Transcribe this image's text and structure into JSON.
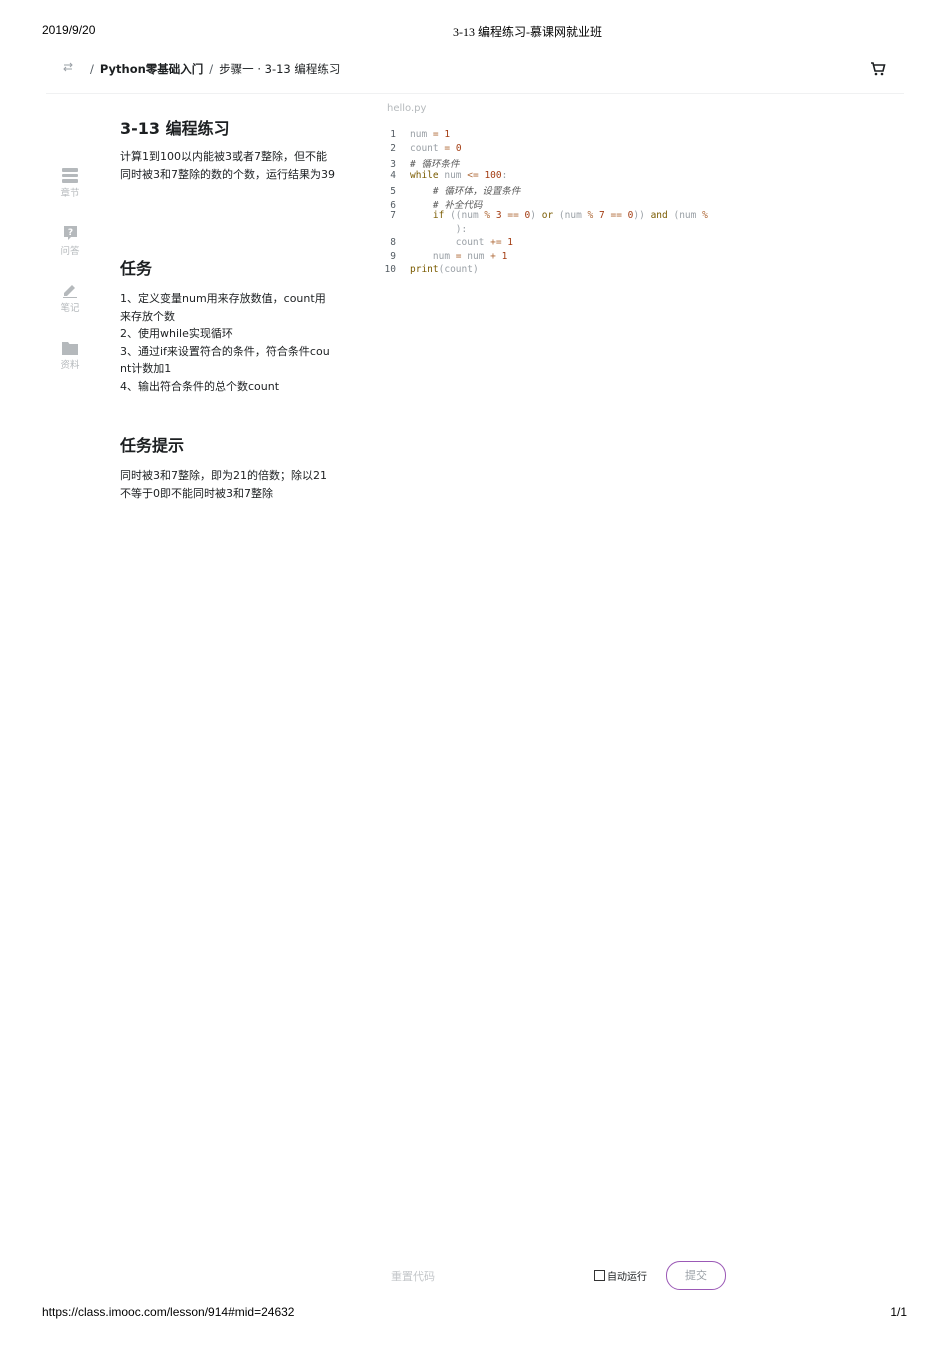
{
  "print_header": {
    "date": "2019/9/20",
    "title": "3-13 编程练习-慕课网就业班"
  },
  "print_footer": {
    "url": "https://class.imooc.com/lesson/914#mid=24632",
    "page": "1/1"
  },
  "topbar": {
    "separator": "/",
    "course": "Python零基础入门",
    "step": "步骤一 · 3-13 编程练习",
    "icons": {
      "swap": "swap-arrows-icon",
      "cart": "cart-icon"
    }
  },
  "sidenav": [
    {
      "label": "章节",
      "icon": "chapter-list-icon"
    },
    {
      "label": "问答",
      "icon": "question-icon"
    },
    {
      "label": "笔记",
      "icon": "pencil-icon"
    },
    {
      "label": "资料",
      "icon": "folder-icon"
    }
  ],
  "exercise": {
    "title": "3-13 编程练习",
    "description": "计算1到100以内能被3或者7整除，但不能同时被3和7整除的数的个数，运行结果为39",
    "task_heading": "任务",
    "tasks": [
      "1、定义变量num用来存放数值，count用来存放个数",
      "2、使用while实现循环",
      "3、通过if来设置符合的条件，符合条件count计数加1",
      "4、输出符合条件的总个数count"
    ],
    "hint_heading": "任务提示",
    "hint": "同时被3和7整除，即为21的倍数；除以21不等于0即不能同时被3和7整除"
  },
  "editor": {
    "file_name": "hello.py",
    "line_numbers": [
      "1",
      "2",
      "3",
      "4",
      "5",
      "6",
      "7",
      "",
      "8",
      "9",
      "10"
    ],
    "code_lines": [
      "num = 1",
      "count = 0",
      "# 循环条件",
      "while num <= 100:",
      "    # 循环体，设置条件",
      "    # 补全代码",
      "    if ((num % 3 == 0) or (num % 7 == 0)) and (num %",
      "        ):",
      "        count += 1",
      "    num = num + 1",
      "print(count)"
    ]
  },
  "footer_bar": {
    "reset_label": "重置代码",
    "auto_run_label": "自动运行",
    "auto_run_checked": false,
    "submit_label": "提交",
    "submit_border_color": "#9b59b6"
  }
}
